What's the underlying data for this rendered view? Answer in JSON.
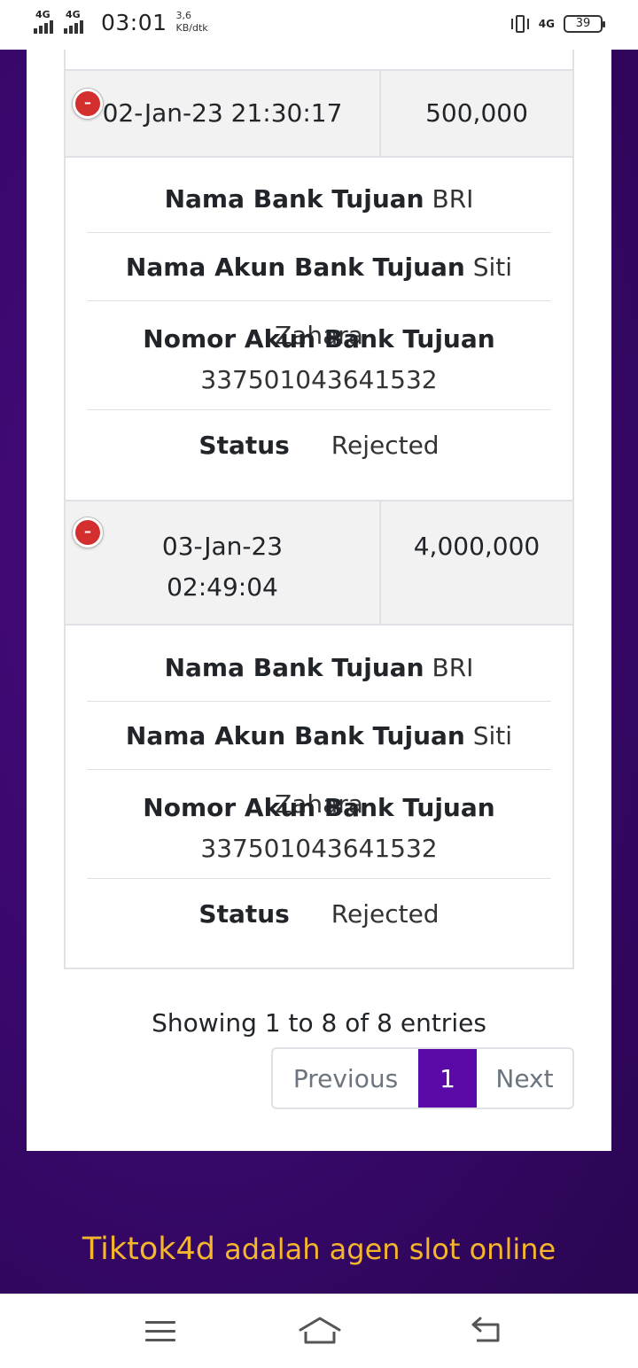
{
  "status_bar": {
    "signal1": "4G",
    "signal2": "4G",
    "time": "03:01",
    "speed_value": "3,6",
    "speed_unit": "KB/dtk",
    "network": "4G",
    "battery": "39"
  },
  "transactions": [
    {
      "date": "02-Jan-23 21:30:17",
      "amount": "500,000",
      "bank_label": "Nama Bank Tujuan",
      "bank_value": "BRI",
      "account_name_label": "Nama Akun Bank Tujuan",
      "account_name_value": "Siti Zahara",
      "account_number_label": "Nomor Akun Bank Tujuan",
      "account_number_value": "337501043641532",
      "status_label": "Status",
      "status_value": "Rejected"
    },
    {
      "date_line1": "03-Jan-23",
      "date_line2": "02:49:04",
      "amount": "4,000,000",
      "bank_label": "Nama Bank Tujuan",
      "bank_value": "BRI",
      "account_name_label": "Nama Akun Bank Tujuan",
      "account_name_value": "Siti Zahara",
      "account_number_label": "Nomor Akun Bank Tujuan",
      "account_number_value": "337501043641532",
      "status_label": "Status",
      "status_value": "Rejected"
    }
  ],
  "toggle_symbol": "–",
  "table_info": "Showing 1 to 8 of 8 entries",
  "pagination": {
    "previous": "Previous",
    "current_page": "1",
    "next": "Next"
  },
  "promo": {
    "brand": "Tiktok4d",
    "text": "adalah agen slot online"
  },
  "colors": {
    "page_background": "#37086a",
    "accent": "#5b0aa8",
    "promo_text": "#f5b52c",
    "toggle_red": "#d32f2f"
  },
  "icons": {
    "menu": "menu-icon",
    "home": "home-icon",
    "back": "back-icon",
    "toggle": "minus-circle-icon"
  }
}
